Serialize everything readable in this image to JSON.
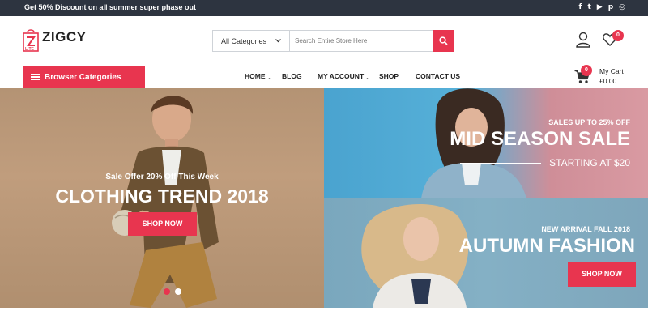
{
  "topbar": {
    "promo": "Get 50% Discount on all summer super phase out",
    "socials": [
      "facebook-icon",
      "twitter-icon",
      "youtube-icon",
      "pinterest-icon",
      "instagram-icon"
    ],
    "social_glyphs": [
      "f",
      "t",
      "▶",
      "p",
      "◎"
    ]
  },
  "header": {
    "logo_name": "ZIGCY",
    "logo_tag": "LITE",
    "search_category": "All Categories",
    "search_placeholder": "Search Entire Store Here",
    "wishlist_count": "0"
  },
  "nav": {
    "browse_label": "Browser Categories",
    "items": [
      {
        "label": "HOME"
      },
      {
        "label": "BLOG"
      },
      {
        "label": "MY ACCOUNT"
      },
      {
        "label": "SHOP"
      },
      {
        "label": "CONTACT US"
      }
    ],
    "cart_count": "0",
    "cart_label": "My Cart",
    "cart_total": "£0.00"
  },
  "banners": {
    "main": {
      "offer": "Sale Offer 20% Off This Week",
      "title": "CLOTHING TREND 2018",
      "button": "SHOP NOW"
    },
    "top_right": {
      "sub": "SALES UP TO 25% OFF",
      "title": "MID SEASON SALE",
      "starting": "STARTING AT $20"
    },
    "bottom_right": {
      "sub": "NEW ARRIVAL FALL 2018",
      "title": "AUTUMN FASHION",
      "button": "SHOP NOW"
    }
  },
  "colors": {
    "accent": "#e8354f",
    "topbar": "#2d3440"
  }
}
